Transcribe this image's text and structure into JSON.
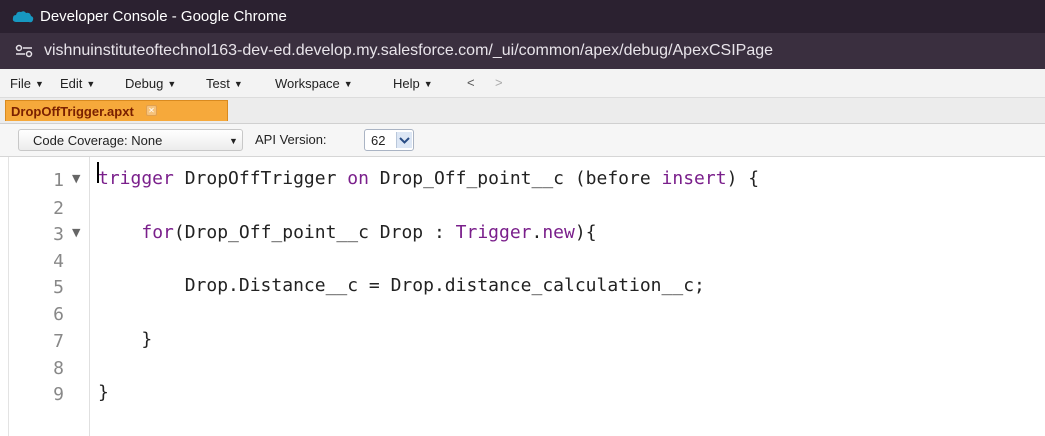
{
  "window": {
    "title": "Developer Console - Google Chrome",
    "icon": "salesforce-cloud-icon",
    "brand_color": "#1798c1"
  },
  "browser": {
    "url": "vishnuinstituteoftechnol163-dev-ed.develop.my.salesforce.com/_ui/common/apex/debug/ApexCSIPage",
    "site_icon": "site-settings-icon"
  },
  "menu": {
    "items": [
      "File",
      "Edit",
      "Debug",
      "Test",
      "Workspace",
      "Help"
    ],
    "back": "<",
    "forward": ">"
  },
  "tabs": [
    {
      "label": "DropOffTrigger.apxt",
      "active": true
    }
  ],
  "toolbar": {
    "coverage_label": "Code Coverage: None",
    "api_label": "API Version:",
    "api_value": "62"
  },
  "editor": {
    "lines": [
      {
        "num": "1",
        "fold": true,
        "tokens": [
          {
            "t": "trigger",
            "k": true
          },
          {
            "t": " DropOffTrigger "
          },
          {
            "t": "on",
            "k": true
          },
          {
            "t": " Drop_Off_point__c (before "
          },
          {
            "t": "insert",
            "k": true
          },
          {
            "t": ") {"
          }
        ]
      },
      {
        "num": "2",
        "fold": false,
        "tokens": []
      },
      {
        "num": "3",
        "fold": true,
        "tokens": [
          {
            "t": "    "
          },
          {
            "t": "for",
            "k": true
          },
          {
            "t": "(Drop_Off_point__c Drop : "
          },
          {
            "t": "Trigger",
            "k": true
          },
          {
            "t": "."
          },
          {
            "t": "new",
            "k": true
          },
          {
            "t": "){"
          }
        ]
      },
      {
        "num": "4",
        "fold": false,
        "tokens": []
      },
      {
        "num": "5",
        "fold": false,
        "tokens": [
          {
            "t": "        Drop.Distance__c = Drop.distance_calculation__c;"
          }
        ]
      },
      {
        "num": "6",
        "fold": false,
        "tokens": []
      },
      {
        "num": "7",
        "fold": false,
        "tokens": [
          {
            "t": "    }"
          }
        ]
      },
      {
        "num": "8",
        "fold": false,
        "tokens": []
      },
      {
        "num": "9",
        "fold": false,
        "tokens": [
          {
            "t": "}"
          }
        ]
      }
    ]
  }
}
